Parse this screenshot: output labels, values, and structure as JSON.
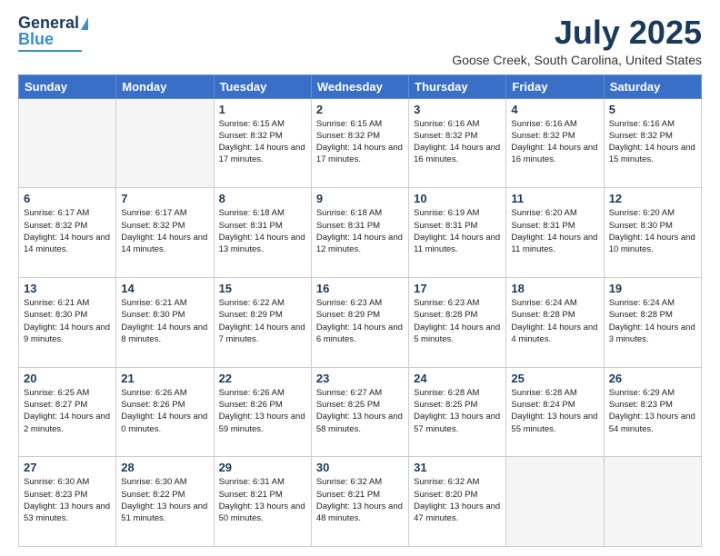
{
  "logo": {
    "line1": "General",
    "line2": "Blue"
  },
  "title": "July 2025",
  "subtitle": "Goose Creek, South Carolina, United States",
  "weekdays": [
    "Sunday",
    "Monday",
    "Tuesday",
    "Wednesday",
    "Thursday",
    "Friday",
    "Saturday"
  ],
  "weeks": [
    [
      {
        "day": "",
        "info": ""
      },
      {
        "day": "",
        "info": ""
      },
      {
        "day": "1",
        "info": "Sunrise: 6:15 AM\nSunset: 8:32 PM\nDaylight: 14 hours and 17 minutes."
      },
      {
        "day": "2",
        "info": "Sunrise: 6:15 AM\nSunset: 8:32 PM\nDaylight: 14 hours and 17 minutes."
      },
      {
        "day": "3",
        "info": "Sunrise: 6:16 AM\nSunset: 8:32 PM\nDaylight: 14 hours and 16 minutes."
      },
      {
        "day": "4",
        "info": "Sunrise: 6:16 AM\nSunset: 8:32 PM\nDaylight: 14 hours and 16 minutes."
      },
      {
        "day": "5",
        "info": "Sunrise: 6:16 AM\nSunset: 8:32 PM\nDaylight: 14 hours and 15 minutes."
      }
    ],
    [
      {
        "day": "6",
        "info": "Sunrise: 6:17 AM\nSunset: 8:32 PM\nDaylight: 14 hours and 14 minutes."
      },
      {
        "day": "7",
        "info": "Sunrise: 6:17 AM\nSunset: 8:32 PM\nDaylight: 14 hours and 14 minutes."
      },
      {
        "day": "8",
        "info": "Sunrise: 6:18 AM\nSunset: 8:31 PM\nDaylight: 14 hours and 13 minutes."
      },
      {
        "day": "9",
        "info": "Sunrise: 6:18 AM\nSunset: 8:31 PM\nDaylight: 14 hours and 12 minutes."
      },
      {
        "day": "10",
        "info": "Sunrise: 6:19 AM\nSunset: 8:31 PM\nDaylight: 14 hours and 11 minutes."
      },
      {
        "day": "11",
        "info": "Sunrise: 6:20 AM\nSunset: 8:31 PM\nDaylight: 14 hours and 11 minutes."
      },
      {
        "day": "12",
        "info": "Sunrise: 6:20 AM\nSunset: 8:30 PM\nDaylight: 14 hours and 10 minutes."
      }
    ],
    [
      {
        "day": "13",
        "info": "Sunrise: 6:21 AM\nSunset: 8:30 PM\nDaylight: 14 hours and 9 minutes."
      },
      {
        "day": "14",
        "info": "Sunrise: 6:21 AM\nSunset: 8:30 PM\nDaylight: 14 hours and 8 minutes."
      },
      {
        "day": "15",
        "info": "Sunrise: 6:22 AM\nSunset: 8:29 PM\nDaylight: 14 hours and 7 minutes."
      },
      {
        "day": "16",
        "info": "Sunrise: 6:23 AM\nSunset: 8:29 PM\nDaylight: 14 hours and 6 minutes."
      },
      {
        "day": "17",
        "info": "Sunrise: 6:23 AM\nSunset: 8:28 PM\nDaylight: 14 hours and 5 minutes."
      },
      {
        "day": "18",
        "info": "Sunrise: 6:24 AM\nSunset: 8:28 PM\nDaylight: 14 hours and 4 minutes."
      },
      {
        "day": "19",
        "info": "Sunrise: 6:24 AM\nSunset: 8:28 PM\nDaylight: 14 hours and 3 minutes."
      }
    ],
    [
      {
        "day": "20",
        "info": "Sunrise: 6:25 AM\nSunset: 8:27 PM\nDaylight: 14 hours and 2 minutes."
      },
      {
        "day": "21",
        "info": "Sunrise: 6:26 AM\nSunset: 8:26 PM\nDaylight: 14 hours and 0 minutes."
      },
      {
        "day": "22",
        "info": "Sunrise: 6:26 AM\nSunset: 8:26 PM\nDaylight: 13 hours and 59 minutes."
      },
      {
        "day": "23",
        "info": "Sunrise: 6:27 AM\nSunset: 8:25 PM\nDaylight: 13 hours and 58 minutes."
      },
      {
        "day": "24",
        "info": "Sunrise: 6:28 AM\nSunset: 8:25 PM\nDaylight: 13 hours and 57 minutes."
      },
      {
        "day": "25",
        "info": "Sunrise: 6:28 AM\nSunset: 8:24 PM\nDaylight: 13 hours and 55 minutes."
      },
      {
        "day": "26",
        "info": "Sunrise: 6:29 AM\nSunset: 8:23 PM\nDaylight: 13 hours and 54 minutes."
      }
    ],
    [
      {
        "day": "27",
        "info": "Sunrise: 6:30 AM\nSunset: 8:23 PM\nDaylight: 13 hours and 53 minutes."
      },
      {
        "day": "28",
        "info": "Sunrise: 6:30 AM\nSunset: 8:22 PM\nDaylight: 13 hours and 51 minutes."
      },
      {
        "day": "29",
        "info": "Sunrise: 6:31 AM\nSunset: 8:21 PM\nDaylight: 13 hours and 50 minutes."
      },
      {
        "day": "30",
        "info": "Sunrise: 6:32 AM\nSunset: 8:21 PM\nDaylight: 13 hours and 48 minutes."
      },
      {
        "day": "31",
        "info": "Sunrise: 6:32 AM\nSunset: 8:20 PM\nDaylight: 13 hours and 47 minutes."
      },
      {
        "day": "",
        "info": ""
      },
      {
        "day": "",
        "info": ""
      }
    ]
  ]
}
